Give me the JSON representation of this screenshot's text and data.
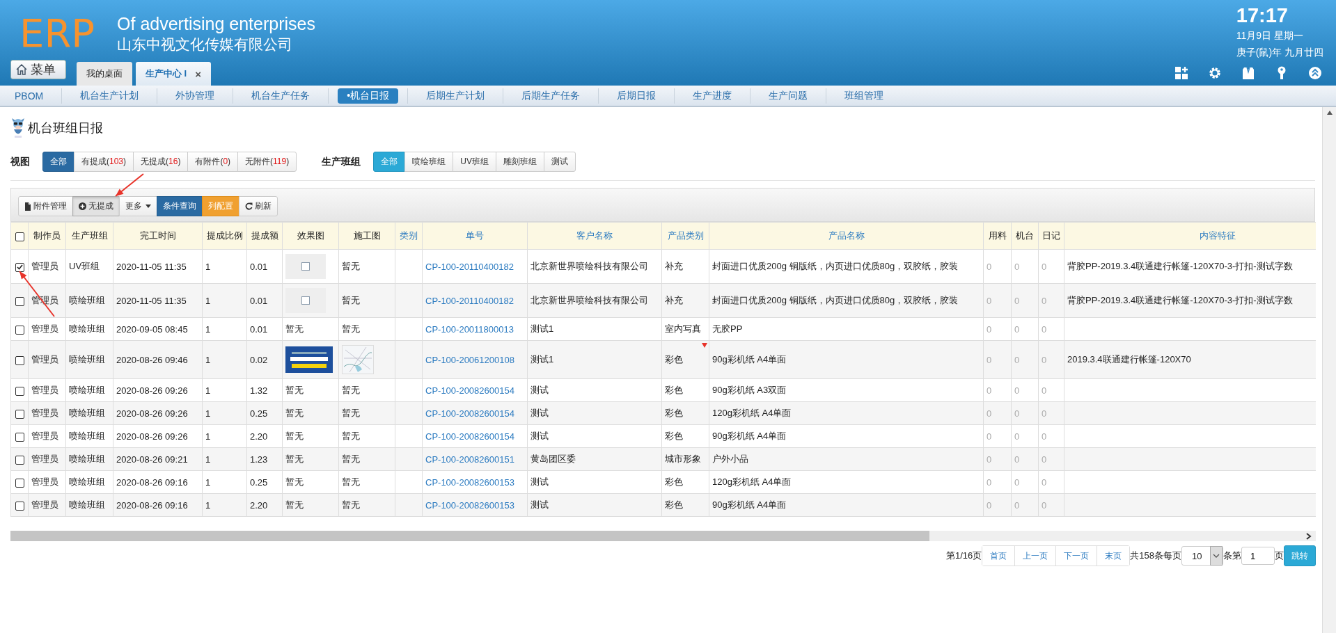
{
  "header": {
    "logo": "ERP",
    "title": "Of advertising enterprises",
    "company": "山东中视文化传媒有限公司",
    "time": "17:17",
    "date": "11月9日 星期一",
    "lunar": "庚子(鼠)年 九月廿四",
    "menu_button": "菜单",
    "tabs": [
      {
        "label": "我的桌面",
        "selected": false
      },
      {
        "label": "生产中心 I",
        "selected": true,
        "close": "×"
      }
    ],
    "tools": [
      {
        "kind": "add-grid"
      },
      {
        "kind": "gear"
      },
      {
        "kind": "shirt"
      },
      {
        "kind": "key"
      },
      {
        "kind": "collapse"
      }
    ]
  },
  "nav": [
    {
      "label": "PBOM",
      "selected": false
    },
    {
      "label": "机台生产计划",
      "selected": false
    },
    {
      "label": "外协管理",
      "selected": false
    },
    {
      "label": "机台生产任务",
      "selected": false
    },
    {
      "label": "•机台日报",
      "selected": true
    },
    {
      "label": "后期生产计划",
      "selected": false
    },
    {
      "label": "后期生产任务",
      "selected": false
    },
    {
      "label": "后期日报",
      "selected": false
    },
    {
      "label": "生产进度",
      "selected": false
    },
    {
      "label": "生产问题",
      "selected": false
    },
    {
      "label": "班组管理",
      "selected": false
    }
  ],
  "page_title": "机台班组日报",
  "filters": [
    {
      "label": "视图",
      "options": [
        {
          "text": "全部",
          "selected": true
        },
        {
          "text": "有提成(",
          "count": "103",
          "close": ")",
          "selected": false
        },
        {
          "text": "无提成(",
          "count": "16",
          "close": ")",
          "selected": false
        },
        {
          "text": "有附件(",
          "count": "0",
          "close": ")",
          "selected": false
        },
        {
          "text": "无附件(",
          "count": "119",
          "close": ")",
          "selected": false
        }
      ]
    },
    {
      "label": "生产班组",
      "options": [
        {
          "text": "全部",
          "selected": true
        },
        {
          "text": "喷绘班组",
          "selected": false
        },
        {
          "text": "UV班组",
          "selected": false
        },
        {
          "text": "雕刻班组",
          "selected": false
        },
        {
          "text": "测试",
          "selected": false
        }
      ]
    }
  ],
  "toolbar": [
    {
      "label": "附件管理",
      "kind": "attach",
      "pressed": false
    },
    {
      "label": "无提成",
      "kind": "toggle",
      "pressed": true
    },
    {
      "label": "更多",
      "kind": "dropdown",
      "pressed": false
    },
    {
      "label": "条件查询",
      "kind": "primary",
      "pressed": false
    },
    {
      "label": "列配置",
      "kind": "warning",
      "pressed": false
    },
    {
      "label": "刷新",
      "kind": "refresh",
      "pressed": false
    }
  ],
  "table": {
    "all_checked": false,
    "columns": [
      {
        "label": "制作员",
        "kind": "text",
        "sortable": false
      },
      {
        "label": "生产班组",
        "kind": "text",
        "sortable": false
      },
      {
        "label": "完工时间",
        "kind": "text",
        "sortable": false
      },
      {
        "label": "提成比例",
        "kind": "text",
        "sortable": false
      },
      {
        "label": "提成额",
        "kind": "text",
        "sortable": false
      },
      {
        "label": "效果图",
        "kind": "text",
        "sortable": false
      },
      {
        "label": "施工图",
        "kind": "text",
        "sortable": false
      },
      {
        "label": "类别",
        "kind": "text",
        "sortable": true
      },
      {
        "label": "单号",
        "kind": "link",
        "sortable": true
      },
      {
        "label": "客户名称",
        "kind": "text",
        "sortable": true
      },
      {
        "label": "产品类别",
        "kind": "text",
        "sortable": true
      },
      {
        "label": "产品名称",
        "kind": "text",
        "sortable": true
      },
      {
        "label": "用料",
        "kind": "muted",
        "sortable": false
      },
      {
        "label": "机台",
        "kind": "muted",
        "sortable": false
      },
      {
        "label": "日记",
        "kind": "muted",
        "sortable": false
      },
      {
        "label": "内容特征",
        "kind": "text",
        "sortable": true
      }
    ],
    "rows": [
      {
        "checked": true,
        "marked": false,
        "cells": [
          "管理员",
          "UV班组",
          "2020-11-05 11:35",
          "1",
          "0.01",
          {
            "kind": "thumb"
          },
          "暂无",
          null,
          "CP-100-20110400182",
          "北京新世界喷绘科技有限公司",
          "补充",
          "封面进口优质200g 铜版纸，内页进口优质80g，双胶纸，胶装",
          "0",
          "0",
          "0",
          "背胶PP-2019.3.4联通建行帐篷-120X70-3-打扣-测试字数"
        ]
      },
      {
        "checked": false,
        "marked": false,
        "cells": [
          "管理员",
          "喷绘班组",
          "2020-11-05 11:35",
          "1",
          "0.01",
          {
            "kind": "thumb"
          },
          "暂无",
          null,
          "CP-100-20110400182",
          "北京新世界喷绘科技有限公司",
          "补充",
          "封面进口优质200g 铜版纸，内页进口优质80g，双胶纸，胶装",
          "0",
          "0",
          "0",
          "背胶PP-2019.3.4联通建行帐篷-120X70-3-打扣-测试字数"
        ]
      },
      {
        "checked": false,
        "marked": false,
        "cells": [
          "管理员",
          "喷绘班组",
          "2020-09-05 08:45",
          "1",
          "0.01",
          "暂无",
          "暂无",
          null,
          "CP-100-20011800013",
          "测试1",
          "室内写真",
          "无胶PP",
          "0",
          "0",
          "0",
          null
        ]
      },
      {
        "checked": false,
        "marked": true,
        "cells": [
          "管理员",
          "喷绘班组",
          "2020-08-26 09:46",
          "1",
          "0.02",
          {
            "kind": "banner"
          },
          {
            "kind": "map"
          },
          null,
          "CP-100-20061200108",
          "测试1",
          "彩色",
          "90g彩机纸 A4单面",
          "0",
          "0",
          "0",
          "2019.3.4联通建行帐篷-120X70"
        ]
      },
      {
        "checked": false,
        "marked": false,
        "cells": [
          "管理员",
          "喷绘班组",
          "2020-08-26 09:26",
          "1",
          "1.32",
          "暂无",
          "暂无",
          null,
          "CP-100-20082600154",
          "测试",
          "彩色",
          "90g彩机纸 A3双面",
          "0",
          "0",
          "0",
          null
        ]
      },
      {
        "checked": false,
        "marked": false,
        "cells": [
          "管理员",
          "喷绘班组",
          "2020-08-26 09:26",
          "1",
          "0.25",
          "暂无",
          "暂无",
          null,
          "CP-100-20082600154",
          "测试",
          "彩色",
          "120g彩机纸 A4单面",
          "0",
          "0",
          "0",
          null
        ]
      },
      {
        "checked": false,
        "marked": false,
        "cells": [
          "管理员",
          "喷绘班组",
          "2020-08-26 09:26",
          "1",
          "2.20",
          "暂无",
          "暂无",
          null,
          "CP-100-20082600154",
          "测试",
          "彩色",
          "90g彩机纸 A4单面",
          "0",
          "0",
          "0",
          null
        ]
      },
      {
        "checked": false,
        "marked": false,
        "cells": [
          "管理员",
          "喷绘班组",
          "2020-08-26 09:21",
          "1",
          "1.23",
          "暂无",
          "暂无",
          null,
          "CP-100-20082600151",
          "黄岛团区委",
          "城市形象",
          "户外小品",
          "0",
          "0",
          "0",
          null
        ]
      },
      {
        "checked": false,
        "marked": false,
        "cells": [
          "管理员",
          "喷绘班组",
          "2020-08-26 09:16",
          "1",
          "0.25",
          "暂无",
          "暂无",
          null,
          "CP-100-20082600153",
          "测试",
          "彩色",
          "120g彩机纸 A4单面",
          "0",
          "0",
          "0",
          null
        ]
      },
      {
        "checked": false,
        "marked": false,
        "cells": [
          "管理员",
          "喷绘班组",
          "2020-08-26 09:16",
          "1",
          "2.20",
          "暂无",
          "暂无",
          null,
          "CP-100-20082600153",
          "测试",
          "彩色",
          "90g彩机纸 A4单面",
          "0",
          "0",
          "0",
          null
        ]
      }
    ]
  },
  "pagination": {
    "page_info": "第1/16页",
    "buttons": [
      "首页",
      "上一页",
      "下一页",
      "末页"
    ],
    "total": "共158条每页",
    "page_size": "10",
    "rows_label": "条第",
    "page_input": "1",
    "page_label": "页",
    "go": "跳转"
  },
  "annotations": [
    {
      "kind": "arrow"
    },
    {
      "kind": "arrow"
    }
  ]
}
